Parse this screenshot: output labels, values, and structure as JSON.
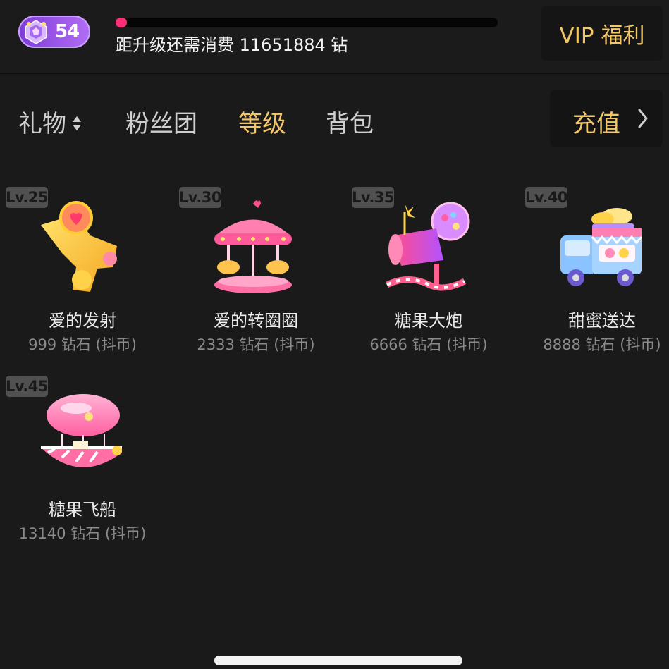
{
  "header": {
    "level": "54",
    "progress_fraction": 0.03,
    "upgrade_text": "距升级还需消费 11651884 钻",
    "vip_label": "VIP 福利"
  },
  "tabs": [
    {
      "label": "礼物",
      "active": false
    },
    {
      "label": "粉丝团",
      "active": false
    },
    {
      "label": "等级",
      "active": true
    },
    {
      "label": "背包",
      "active": false
    }
  ],
  "recharge_label": "充值",
  "gifts": [
    {
      "level": "Lv.25",
      "name": "爱的发射",
      "price": "999 钻石 (抖币)"
    },
    {
      "level": "Lv.30",
      "name": "爱的转圈圈",
      "price": "2333 钻石 (抖币)"
    },
    {
      "level": "Lv.35",
      "name": "糖果大炮",
      "price": "6666 钻石 (抖币)"
    },
    {
      "level": "Lv.40",
      "name": "甜蜜送达",
      "price": "8888 钻石 (抖币)"
    },
    {
      "level": "Lv.45",
      "name": "糖果飞船",
      "price": "13140 钻石 (抖币)"
    }
  ],
  "colors": {
    "accent_gold": "#f3c768",
    "progress_pink": "#ff2e78",
    "badge_purple": "#9b55e8"
  }
}
